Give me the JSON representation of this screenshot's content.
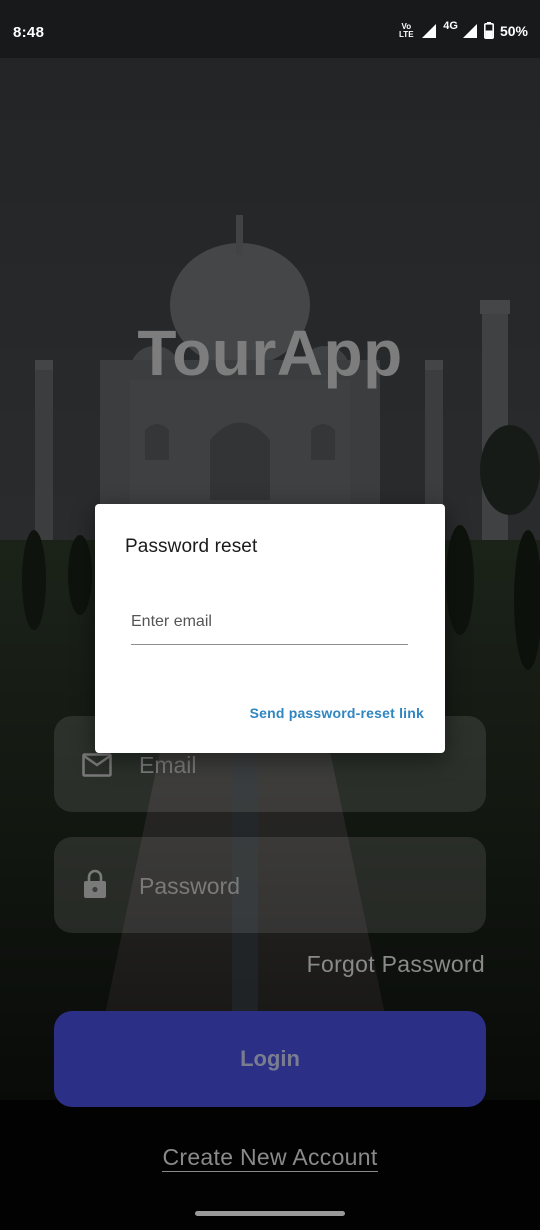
{
  "status_bar": {
    "time": "8:48",
    "volte_line1": "Vo",
    "volte_line2": "LTE",
    "network_type": "4G",
    "battery_percent": "50%"
  },
  "app": {
    "title": "TourApp"
  },
  "login_form": {
    "email_placeholder": "Email",
    "password_placeholder": "Password",
    "forgot_password_label": "Forgot Password",
    "login_button_label": "Login",
    "create_account_label": "Create New Account",
    "login_button_color": "#2b2f86"
  },
  "reset_dialog": {
    "title": "Password reset",
    "email_placeholder": "Enter email",
    "email_value": "",
    "send_link_label": "Send password-reset link",
    "action_color": "#2f86c0"
  },
  "icons": {
    "email_field": "mail-icon",
    "password_field": "lock-icon",
    "signal": "signal-icon",
    "battery": "battery-icon"
  }
}
